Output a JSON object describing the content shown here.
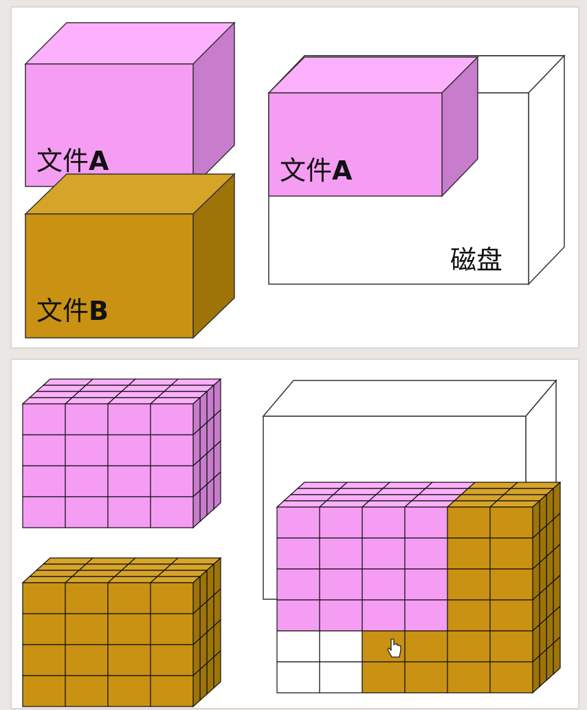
{
  "top_panel": {
    "file_a_label": "文件A",
    "file_b_label": "文件B",
    "disk_file_a_label": "文件A",
    "disk_label": "磁盘"
  },
  "colors": {
    "file_a_front": "#f59df3",
    "file_a_top": "#fcb0fb",
    "file_a_side": "#c87ccc",
    "file_b_front": "#c99212",
    "file_b_top": "#d7a42a",
    "file_b_side": "#9e7409",
    "outline": "#111111",
    "background": "#e9e6e4"
  }
}
